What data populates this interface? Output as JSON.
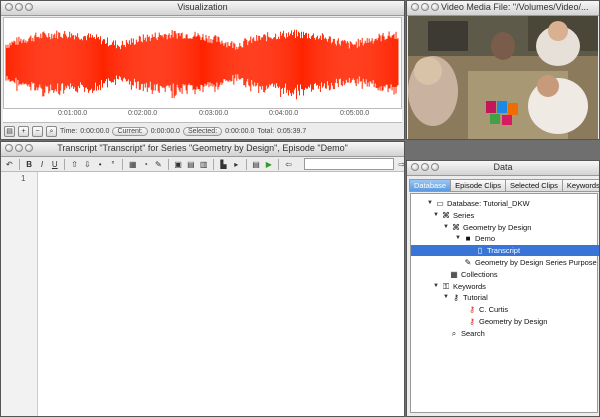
{
  "visualization": {
    "title": "Visualization",
    "ticks": [
      "0:01:00.0",
      "0:02:00.0",
      "0:03:00.0",
      "0:04:00.0",
      "0:05:00.0"
    ],
    "time_label": "Time:",
    "time_value": "0:00:00.0",
    "current_label": "Current:",
    "current_value": "0:00:00.0",
    "selected_label": "Selected:",
    "selected_value": "0:00:00.0",
    "total_label": "Total:",
    "total_value": "0:05:39.7",
    "wave_color": "#ff2400"
  },
  "video": {
    "title": "Video Media File: \"/Volumes/Video/..."
  },
  "transcript": {
    "title": "Transcript \"Transcript\" for Series \"Geometry by Design\", Episode \"Demo\"",
    "line_number": "1"
  },
  "data_window": {
    "title": "Data",
    "tabs": [
      "Database",
      "Episode Clips",
      "Selected Clips",
      "Keywords"
    ],
    "tree": [
      {
        "label": "Database: Tutorial_DKW",
        "icon": "database-icon",
        "expanded": true
      },
      {
        "label": "Series",
        "icon": "series-icon",
        "expanded": true
      },
      {
        "label": "Geometry by Design",
        "icon": "series-icon",
        "expanded": true
      },
      {
        "label": "Demo",
        "icon": "episode-icon",
        "expanded": true
      },
      {
        "label": "Transcript",
        "icon": "transcript-icon",
        "selected": true
      },
      {
        "label": "Geometry by Design Series Purpose",
        "icon": "note-icon"
      },
      {
        "label": "Collections",
        "icon": "collections-icon"
      },
      {
        "label": "Keywords",
        "icon": "keywords-icon",
        "expanded": true
      },
      {
        "label": "Tutorial",
        "icon": "keyword-group-icon",
        "expanded": true
      },
      {
        "label": "C. Curtis",
        "icon": "keyword-icon"
      },
      {
        "label": "Geometry by Design",
        "icon": "keyword-icon"
      },
      {
        "label": "Search",
        "icon": "search-icon"
      }
    ],
    "selection_color": "#3875d7"
  }
}
